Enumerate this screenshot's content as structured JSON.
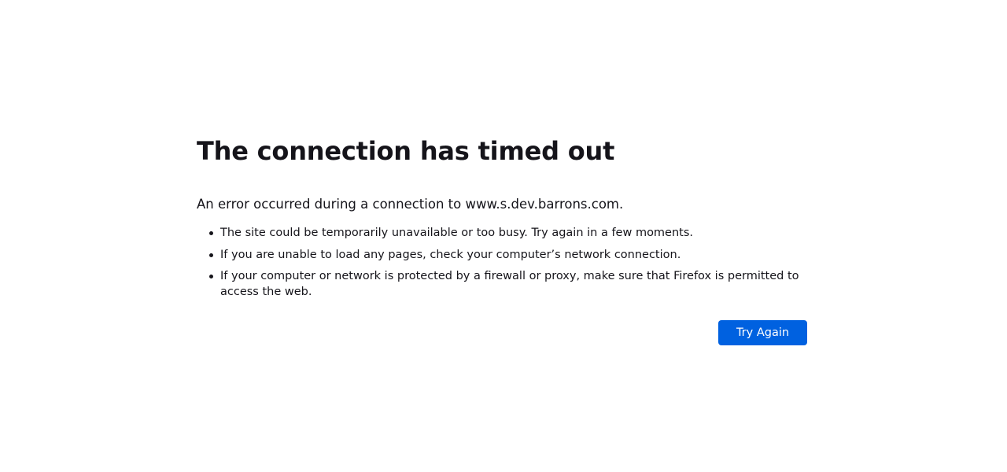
{
  "error_page": {
    "title": "The connection has timed out",
    "description": "An error occurred during a connection to www.s.dev.barrons.com.",
    "reasons": [
      "The site could be temporarily unavailable or too busy. Try again in a few moments.",
      "If you are unable to load any pages, check your computer’s network connection.",
      "If your computer or network is protected by a firewall or proxy, make sure that Firefox is permitted to access the web."
    ],
    "try_again_label": "Try Again"
  },
  "colors": {
    "button_background": "#0061e0",
    "button_text": "#ffffff",
    "text": "#15141a",
    "page_background": "#ffffff"
  }
}
